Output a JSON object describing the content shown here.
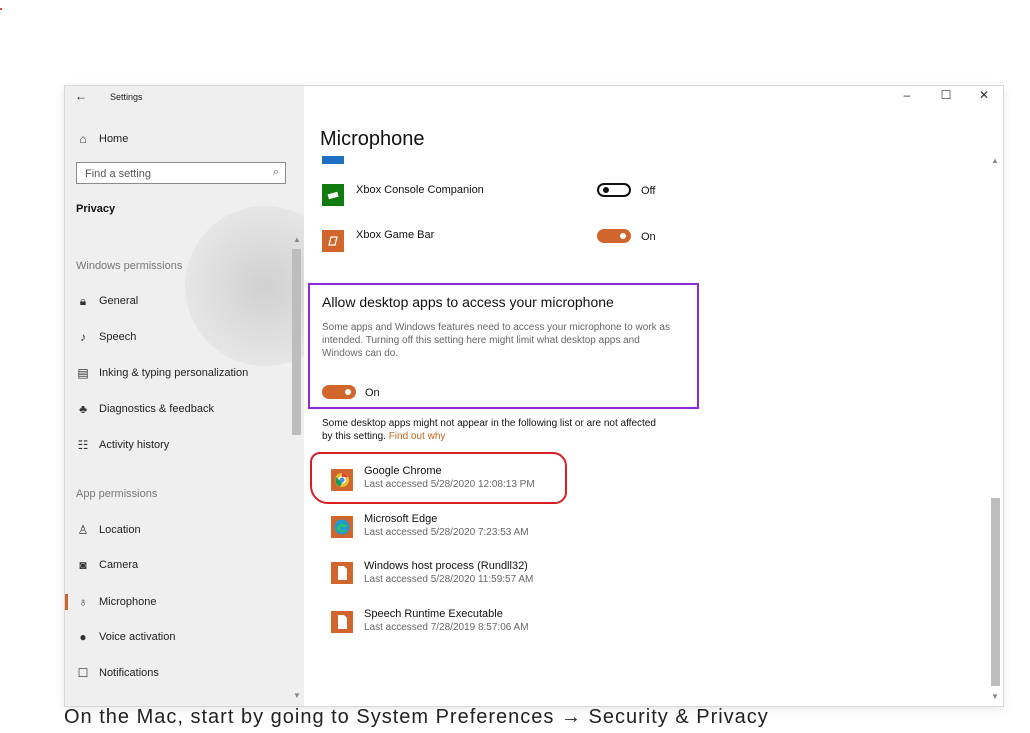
{
  "window": {
    "title": "Settings",
    "back_icon": "←",
    "controls": {
      "minimize": "–",
      "maximize": "☐",
      "close": "✕"
    }
  },
  "sidebar": {
    "home": {
      "icon": "⌂",
      "label": "Home"
    },
    "search_placeholder": "Find a setting",
    "search_icon": "⌕",
    "privacy_label": "Privacy",
    "windows_permissions_header": "Windows permissions",
    "windows_permissions": [
      {
        "icon": "🔒︎",
        "label": "General"
      },
      {
        "icon": "♪",
        "label": "Speech"
      },
      {
        "icon": "▤",
        "label": "Inking & typing personalization"
      },
      {
        "icon": "♣",
        "label": "Diagnostics & feedback"
      },
      {
        "icon": "☷",
        "label": "Activity history"
      }
    ],
    "app_permissions_header": "App permissions",
    "app_permissions": [
      {
        "icon": "♙",
        "label": "Location"
      },
      {
        "icon": "◙",
        "label": "Camera"
      },
      {
        "icon": "♁",
        "label": "Microphone",
        "active": true
      },
      {
        "icon": "●",
        "label": "Voice activation"
      },
      {
        "icon": "☐",
        "label": "Notifications"
      }
    ]
  },
  "content": {
    "page_title": "Microphone",
    "apps": [
      {
        "name": "Xbox Console Companion",
        "state": "Off",
        "color": "#107c10"
      },
      {
        "name": "Xbox Game Bar",
        "state": "On",
        "color": "#d0662b"
      }
    ],
    "desktop": {
      "title": "Allow desktop apps to access your microphone",
      "description": "Some apps and Windows features need to access your microphone to work as intended. Turning off this setting here might limit what desktop apps and Windows can do.",
      "toggle_state": "On",
      "note": "Some desktop apps might not appear in the following list or are not affected by this setting.",
      "note_link": "Find out why"
    },
    "desktop_apps": [
      {
        "name": "Google Chrome",
        "last": "Last accessed 5/28/2020 12:08:13 PM"
      },
      {
        "name": "Microsoft Edge",
        "last": "Last accessed 5/28/2020 7:23:53 AM"
      },
      {
        "name": "Windows host process (Rundll32)",
        "last": "Last accessed 5/28/2020 11:59:57 AM"
      },
      {
        "name": "Speech Runtime Executable",
        "last": "Last accessed 7/28/2019 8:57:06 AM"
      }
    ]
  },
  "colors": {
    "accent": "#d0662b",
    "highlight_purple": "#8f2ad6",
    "highlight_red": "#d81f26"
  },
  "caption": "On the Mac, start by going to System Preferences → Security & Privacy"
}
